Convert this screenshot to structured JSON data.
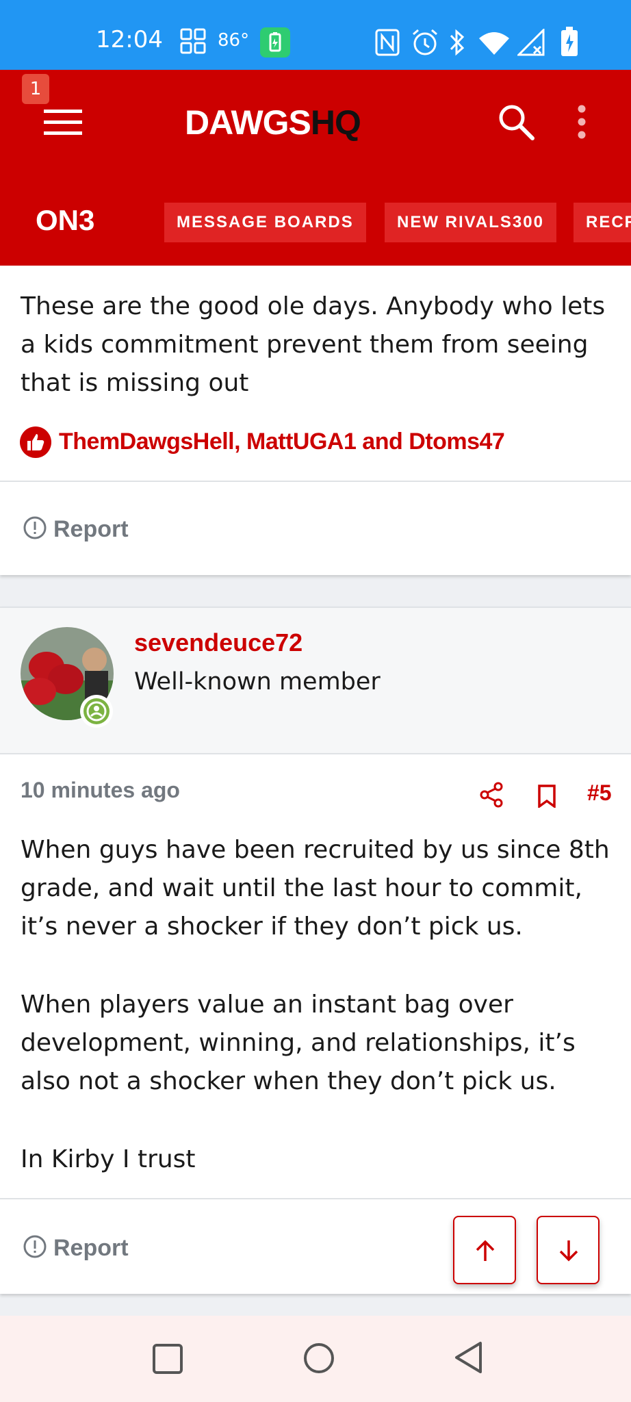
{
  "status_bar": {
    "time": "12:04",
    "temperature": "86°"
  },
  "header": {
    "notification_count": "1",
    "logo_main": "DAWGS",
    "logo_accent": "HQ",
    "brand": "ON3",
    "nav_items": [
      "MESSAGE BOARDS",
      "NEW RIVALS300",
      "RECR"
    ]
  },
  "previous_post": {
    "body": "These are the good ole days. Anybody who lets a kids commitment prevent them from seeing that is missing out",
    "likes": "ThemDawgsHell, MattUGA1 and Dtoms47",
    "report_label": "Report"
  },
  "post": {
    "username": "sevendeuce72",
    "user_title": "Well-known member",
    "time_ago": "10 minutes ago",
    "post_number": "#5",
    "paragraphs": [
      "When guys have been recruited by us since 8th grade, and wait until the last hour to commit, it’s never a shocker if they don’t pick us.",
      "When players value an instant bag over development, winning, and relationships, it’s also not a shocker when they don’t pick us.",
      "In Kirby I trust"
    ],
    "report_label": "Report"
  },
  "colors": {
    "brand_red": "#cc0000",
    "status_blue": "#2196f3"
  }
}
